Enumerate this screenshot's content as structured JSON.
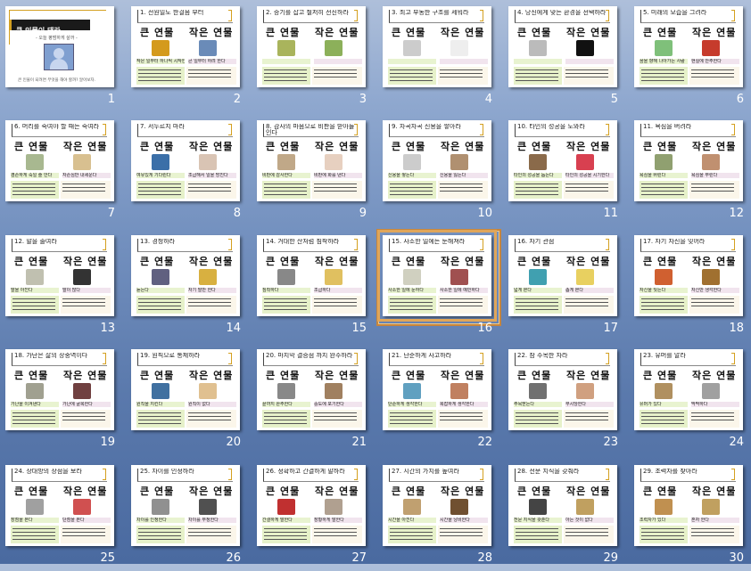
{
  "app": "slide sorter",
  "colors": {
    "accent": "#d4a020",
    "selection": "#c6853c",
    "captionGreen": "#e6f1c9",
    "captionPink": "#f1e4ee"
  },
  "title_slide": {
    "title": "큰 인물이 돼라",
    "subtitle": "- 오늘 평범하게 살까 -",
    "footer": "큰 인물이 되려면 무엇을 해야 할까? 알아보자."
  },
  "selected_slide": 16,
  "slides": [
    {
      "num": "1",
      "title": "",
      "big": "",
      "small": "",
      "capA": "",
      "capB": ""
    },
    {
      "num": "2",
      "title": "1. 전원일도 한걸음 부터",
      "big": "큰 연물",
      "small": "작은 연물",
      "capA": "작은 일부터 하나씩 시작한다",
      "capB": "큰 일부터 하려 한다"
    },
    {
      "num": "3",
      "title": "2. 승기를 잡고 철저히 전진하라",
      "big": "큰 연물",
      "small": "작은 연물",
      "capA": "",
      "capB": ""
    },
    {
      "num": "4",
      "title": "3. 최고 부동한 구조를 세워라",
      "big": "큰 연물",
      "small": "작은 연물",
      "capA": "",
      "capB": ""
    },
    {
      "num": "5",
      "title": "4. 당신에게 맞는 환경을 선택하라",
      "big": "큰 연물",
      "small": "작은 연물",
      "capA": "",
      "capB": ""
    },
    {
      "num": "6",
      "title": "5. 미래의 모습을 그려라",
      "big": "큰 연물",
      "small": "작은 연물",
      "capA": "꿈을 향해 나아가는 사람",
      "capB": "현실에 안주한다"
    },
    {
      "num": "7",
      "title": "6. 머리를 숙여야 할 때는 숙여라",
      "big": "큰 연물",
      "small": "작은 연물",
      "capA": "겸손하게 숙일 줄 안다",
      "capB": "자존심만 내세운다"
    },
    {
      "num": "8",
      "title": "7. 서두르지 마라",
      "big": "큰 연물",
      "small": "작은 연물",
      "capA": "여유있게 기다린다",
      "capB": "조급해서 일을 망친다"
    },
    {
      "num": "9",
      "title": "8. 감사의 마음으로 비판을 받아들인다",
      "big": "큰 연물",
      "small": "작은 연물",
      "capA": "비판에 감사한다",
      "capB": "비판에 화를 낸다"
    },
    {
      "num": "10",
      "title": "9. 차곡차곡 신용을 쌓아라",
      "big": "큰 연물",
      "small": "작은 연물",
      "capA": "신용을 쌓는다",
      "capB": "신용을 잃는다"
    },
    {
      "num": "11",
      "title": "10. 타인의 성공을 도와라",
      "big": "큰 연물",
      "small": "작은 연물",
      "capA": "타인의 성공을 돕는다",
      "capB": "타인의 성공을 시기한다"
    },
    {
      "num": "12",
      "title": "11. 욕심을 버려라",
      "big": "큰 연물",
      "small": "작은 연물",
      "capA": "욕심을 버린다",
      "capB": "욕심을 부린다"
    },
    {
      "num": "13",
      "title": "12. 말을 줄여라",
      "big": "큰 연물",
      "small": "작은 연물",
      "capA": "말을 아낀다",
      "capB": "말이 많다"
    },
    {
      "num": "14",
      "title": "13. 경청하라",
      "big": "큰 연물",
      "small": "작은 연물",
      "capA": "듣는다",
      "capB": "자기 말만 한다"
    },
    {
      "num": "15",
      "title": "14. 거대한 산처럼 침착하라",
      "big": "큰 연물",
      "small": "작은 연물",
      "capA": "침착하다",
      "capB": "조급하다"
    },
    {
      "num": "16",
      "title": "15. 사소한 일에는 둔해져라",
      "big": "큰 연물",
      "small": "작은 연물",
      "capA": "사소한 일에 둔하다",
      "capB": "사소한 일에 예민하다"
    },
    {
      "num": "17",
      "title": "16. 자기 관점",
      "big": "큰 연물",
      "small": "작은 연물",
      "capA": "넓게 본다",
      "capB": "좁게 본다"
    },
    {
      "num": "18",
      "title": "17. 자기 자신을 잊어라",
      "big": "큰 연물",
      "small": "작은 연물",
      "capA": "자신을 잊는다",
      "capB": "자신만 생각한다"
    },
    {
      "num": "19",
      "title": "18. 가난은 삶의 장중역이다",
      "big": "큰 연물",
      "small": "작은 연물",
      "capA": "가난을 이겨낸다",
      "capB": "가난에 굴복한다"
    },
    {
      "num": "20",
      "title": "19. 원칙으로 통제하라",
      "big": "큰 연물",
      "small": "작은 연물",
      "capA": "원칙을 지킨다",
      "capB": "원칙이 없다"
    },
    {
      "num": "21",
      "title": "20. 마지막 결승점 까지 완주하라",
      "big": "큰 연물",
      "small": "작은 연물",
      "capA": "끝까지 완주한다",
      "capB": "중도에 포기한다"
    },
    {
      "num": "22",
      "title": "21. 단순하게 사고하라",
      "big": "큰 연물",
      "small": "작은 연물",
      "capA": "단순하게 생각한다",
      "capB": "복잡하게 생각한다"
    },
    {
      "num": "23",
      "title": "22. 참 주목한 자라",
      "big": "큰 연물",
      "small": "작은 연물",
      "capA": "주목받는다",
      "capB": "무시당한다"
    },
    {
      "num": "24",
      "title": "23. 유머를 알라",
      "big": "큰 연물",
      "small": "작은 연물",
      "capA": "유머가 있다",
      "capB": "딱딱하다"
    },
    {
      "num": "25",
      "title": "24. 상대방의 장점을 보라",
      "big": "큰 연물",
      "small": "작은 연물",
      "capA": "장점을 본다",
      "capB": "단점을 본다"
    },
    {
      "num": "26",
      "title": "25. 차이를 인정하라",
      "big": "큰 연물",
      "small": "작은 연물",
      "capA": "차이를 인정한다",
      "capB": "차이를 부정한다"
    },
    {
      "num": "27",
      "title": "26. 정확하고 간결하게 말하라",
      "big": "큰 연물",
      "small": "작은 연물",
      "capA": "간결하게 말한다",
      "capB": "장황하게 말한다"
    },
    {
      "num": "28",
      "title": "27. 시간의 가치를 높여라",
      "big": "큰 연물",
      "small": "작은 연물",
      "capA": "시간을 아낀다",
      "capB": "시간을 낭비한다"
    },
    {
      "num": "29",
      "title": "28. 전문 지식을 갖춰라",
      "big": "큰 연물",
      "small": "작은 연물",
      "capA": "전문 지식을 갖춘다",
      "capB": "아는 것이 없다"
    },
    {
      "num": "30",
      "title": "29. 조력자를 찾아라",
      "big": "큰 연물",
      "small": "작은 연물",
      "capA": "조력자가 있다",
      "capB": "혼자 한다"
    }
  ],
  "thumb_colors": [
    [
      "#d49a1c",
      "#6a8bb8"
    ],
    [
      "#a9b45c",
      "#8cb05a"
    ],
    [
      "#ccc",
      "#eee"
    ],
    [
      "#bbb",
      "#111"
    ],
    [
      "#7fc07a",
      "#c63b2c"
    ],
    [
      "#a8b890",
      "#d8c090"
    ],
    [
      "#3b6fa8",
      "#d9c4b4"
    ],
    [
      "#c0a888",
      "#e7d0c0"
    ],
    [
      "#ccc",
      "#b09070"
    ],
    [
      "#8a6a4a",
      "#d84050"
    ],
    [
      "#90a070",
      "#c09070"
    ],
    [
      "#c0c0b0",
      "#333"
    ],
    [
      "#606080",
      "#d8b040"
    ],
    [
      "#888",
      "#e0c060"
    ],
    [
      "#d0d0c0",
      "#a05050"
    ],
    [
      "#40a0b0",
      "#e8d060"
    ],
    [
      "#d06030",
      "#a07030"
    ],
    [
      "#a0a090",
      "#704040"
    ],
    [
      "#4070a0",
      "#e0c090"
    ],
    [
      "#888",
      "#a08060"
    ],
    [
      "#60a0c0",
      "#c08060"
    ],
    [
      "#707070",
      "#d0a080"
    ],
    [
      "#b09060",
      "#a0a0a0"
    ],
    [
      "#a0a0a0",
      "#d05050"
    ],
    [
      "#909090",
      "#505050"
    ],
    [
      "#c03030",
      "#b0a090"
    ],
    [
      "#c0a070",
      "#705030"
    ],
    [
      "#444",
      "#c0a060"
    ],
    [
      "#c09050",
      "#c0a060"
    ]
  ]
}
